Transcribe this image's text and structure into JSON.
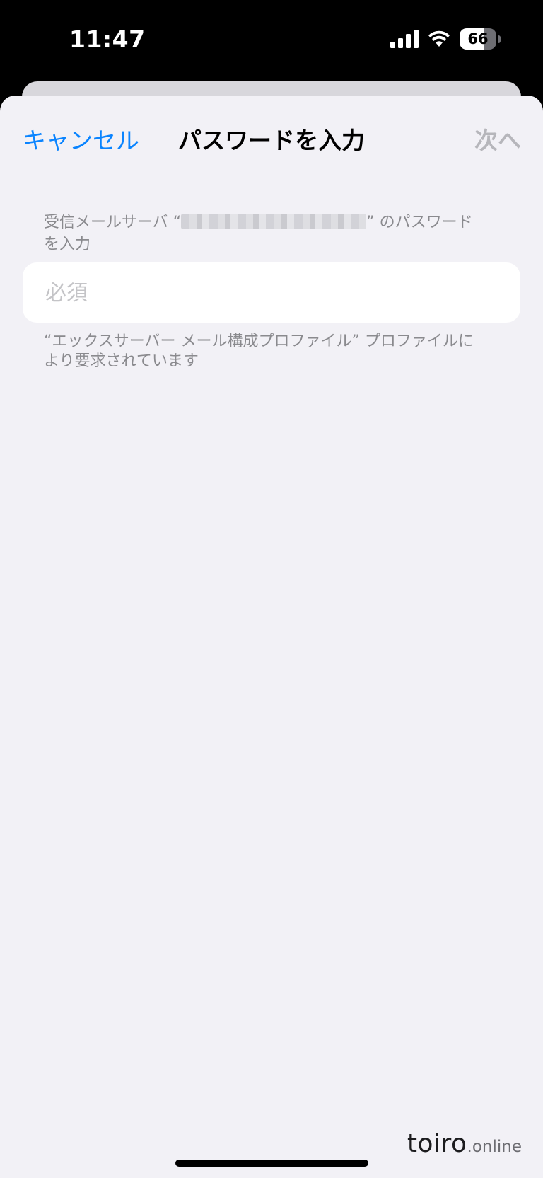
{
  "status_bar": {
    "time": "11:47",
    "battery_level": "66",
    "battery_fill_fraction": 0.66,
    "icons": [
      "cellular-signal-icon",
      "wifi-icon",
      "battery-icon"
    ]
  },
  "nav": {
    "cancel_label": "キャンセル",
    "title": "パスワードを入力",
    "next_label": "次へ"
  },
  "form": {
    "header_prefix": "受信メールサーバ “",
    "header_suffix": "” のパスワードを入力",
    "password_placeholder": "必須",
    "password_value": "",
    "footer_note": "“エックスサーバー メール構成プロファイル” プロファイルにより要求されています"
  },
  "watermark": {
    "main": "toiro",
    "sub": ".online"
  },
  "colors": {
    "accent": "#0a84ff",
    "disabled": "#b6b6bb",
    "background": "#f2f1f6",
    "secondary_text": "#8a8a8e"
  }
}
